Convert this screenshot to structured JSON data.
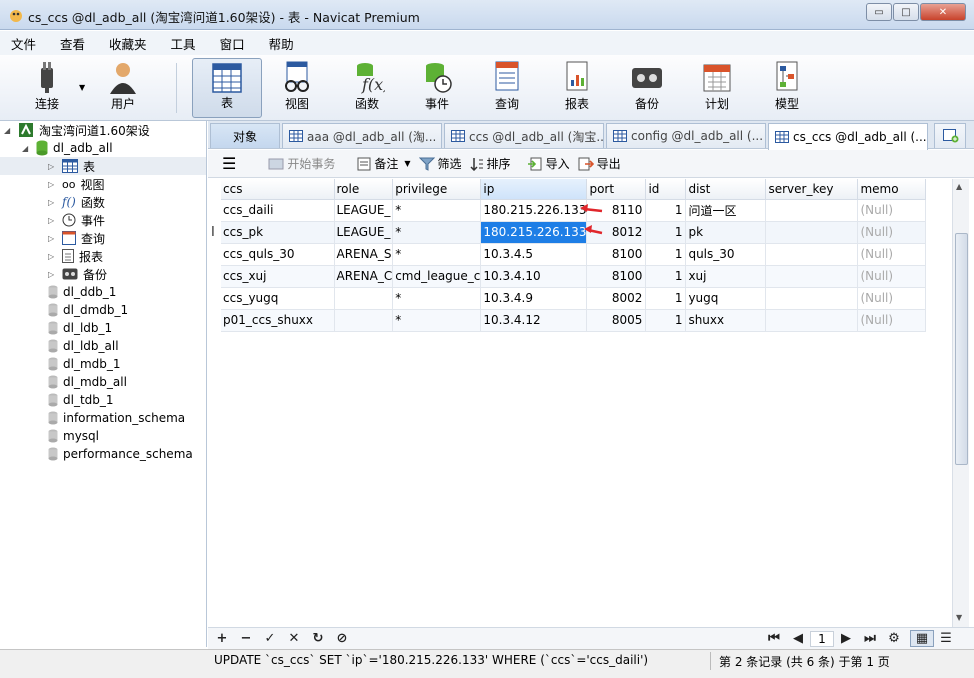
{
  "window": {
    "title": "cs_ccs @dl_adb_all (淘宝湾问道1.60架设) - 表 - Navicat Premium",
    "controls": [
      "▭",
      "□",
      "✕"
    ]
  },
  "menu": [
    "文件",
    "查看",
    "收藏夹",
    "工具",
    "窗口",
    "帮助"
  ],
  "toolbar": {
    "connect": "连接",
    "user": "用户",
    "table": "表",
    "view": "视图",
    "function": "函数",
    "event": "事件",
    "query": "查询",
    "report": "报表",
    "backup": "备份",
    "schedule": "计划",
    "model": "模型"
  },
  "sidebar": {
    "connection": "淘宝湾问道1.60架设",
    "database": "dl_adb_all",
    "children": [
      "表",
      "视图",
      "函数",
      "事件",
      "查询",
      "报表",
      "备份"
    ],
    "other_dbs": [
      "dl_ddb_1",
      "dl_dmdb_1",
      "dl_ldb_1",
      "dl_ldb_all",
      "dl_mdb_1",
      "dl_mdb_all",
      "dl_tdb_1",
      "information_schema",
      "mysql",
      "performance_schema"
    ]
  },
  "tabs": {
    "objects": "对象",
    "items": [
      "aaa @dl_adb_all (淘...",
      "ccs @dl_adb_all (淘宝...",
      "config @dl_adb_all (...",
      "cs_ccs @dl_adb_all (..."
    ]
  },
  "subtoolbar": {
    "begin_tx": "开始事务",
    "memo": "备注",
    "filter": "筛选",
    "sort": "排序",
    "import": "导入",
    "export": "导出"
  },
  "grid": {
    "columns": [
      "ccs",
      "role",
      "privilege",
      "ip",
      "port",
      "id",
      "dist",
      "server_key",
      "memo"
    ],
    "rows": [
      [
        "ccs_daili",
        "LEAGUE_",
        "*",
        "180.215.226.133",
        "8110",
        "1",
        "问道一区",
        "",
        "(Null)"
      ],
      [
        "ccs_pk",
        "LEAGUE_",
        "*",
        "180.215.226.133",
        "8012",
        "1",
        "pk",
        "",
        "(Null)"
      ],
      [
        "ccs_quls_30",
        "ARENA_S",
        "*",
        "10.3.4.5",
        "8100",
        "1",
        "quls_30",
        "",
        "(Null)"
      ],
      [
        "ccs_xuj",
        "ARENA_C",
        "cmd_league_c",
        "10.3.4.10",
        "8100",
        "1",
        "xuj",
        "",
        "(Null)"
      ],
      [
        "ccs_yugq",
        "",
        "*",
        "10.3.4.9",
        "8002",
        "1",
        "yugq",
        "",
        "(Null)"
      ],
      [
        "p01_ccs_shuxx",
        "",
        "*",
        "10.3.4.12",
        "8005",
        "1",
        "shuxx",
        "",
        "(Null)"
      ]
    ],
    "current_row_marker": "I"
  },
  "nav": {
    "page": "1"
  },
  "status": {
    "sql": "UPDATE `cs_ccs` SET `ip`='180.215.226.133' WHERE (`ccs`='ccs_daili')",
    "record": "第 2 条记录 (共 6 条) 于第 1 页"
  },
  "colors": {
    "selection": "#1e7ee6",
    "arrow": "#e0262b",
    "db_icon": "#5db135"
  }
}
